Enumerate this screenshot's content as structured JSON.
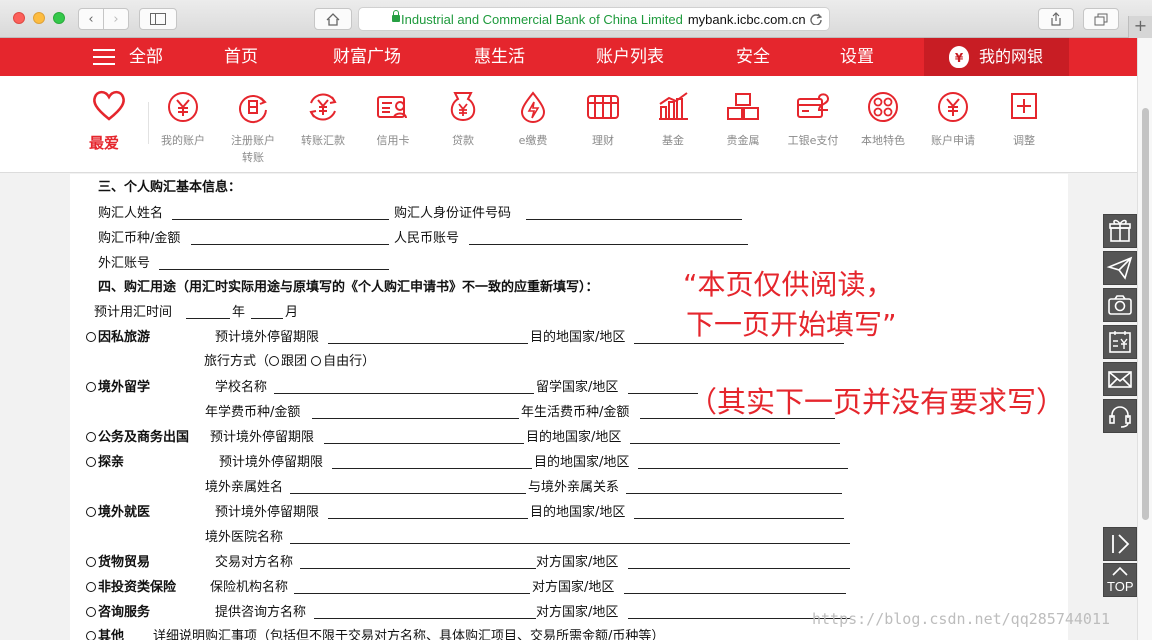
{
  "browser": {
    "url_org": "Industrial and Commercial Bank of China Limited",
    "url_host": "mybank.icbc.com.cn"
  },
  "nav": {
    "all": "全部",
    "items": [
      "首页",
      "财富广场",
      "惠生活",
      "账户列表",
      "安全",
      "设置"
    ],
    "mybank": "我的网银"
  },
  "iconbar": {
    "favorite": "最爱",
    "items": [
      {
        "label": "我的账户",
        "icon": "yuan-coin-icon"
      },
      {
        "label": "注册账户\n转账",
        "icon": "register-transfer-icon"
      },
      {
        "label": "转账汇款",
        "icon": "transfer-icon"
      },
      {
        "label": "信用卡",
        "icon": "credit-card-icon"
      },
      {
        "label": "贷款",
        "icon": "money-bag-icon"
      },
      {
        "label": "e缴费",
        "icon": "flame-drop-icon"
      },
      {
        "label": "理财",
        "icon": "abacus-icon"
      },
      {
        "label": "基金",
        "icon": "bar-chart-icon"
      },
      {
        "label": "贵金属",
        "icon": "gold-bars-icon"
      },
      {
        "label": "工银e支付",
        "icon": "e-pay-card-icon"
      },
      {
        "label": "本地特色",
        "icon": "local-dots-icon"
      },
      {
        "label": "账户申请",
        "icon": "account-apply-icon"
      },
      {
        "label": "调整",
        "icon": "plus-square-icon"
      }
    ],
    "accent": "#e5262d"
  },
  "form": {
    "sec3_title": "三、个人购汇基本信息：",
    "buyer_name": "购汇人姓名",
    "buyer_id": "购汇人身份证件号码",
    "currency_amount": "购汇币种/金额",
    "rmb_account": "人民币账号",
    "fx_account": "外汇账号",
    "sec4_title": "四、购汇用途（用汇时实际用途与原填写的《个人购汇申请书》不一致的应重新填写）：",
    "planned_time": "预计用汇时间",
    "year": "年",
    "month": "月",
    "travel": "因私旅游",
    "stay_period": "预计境外停留期限",
    "dest": "目的地国家/地区",
    "travel_mode": "旅行方式（",
    "group": "跟团",
    "self_guided": "自由行）",
    "study": "境外留学",
    "school": "学校名称",
    "study_country": "留学国家/地区",
    "tuition": "年学费币种/金额",
    "living": "年生活费币种/金额",
    "business": "公务及商务出国",
    "visit": "探亲",
    "relative_name": "境外亲属姓名",
    "relation": "与境外亲属关系",
    "medical": "境外就医",
    "hospital": "境外医院名称",
    "trade": "货物贸易",
    "counterparty": "交易对方名称",
    "counter_country": "对方国家/地区",
    "insurance": "非投资类保险",
    "insurer": "保险机构名称",
    "consulting": "咨询服务",
    "provider": "提供咨询方名称",
    "other": "其他",
    "other_desc": "详细说明购汇事项（包括但不限于交易对方名称、具体购汇项目、交易所需金额/币种等）"
  },
  "annotation": {
    "line1": "“本页仅供阅读，",
    "line2": "下一页开始填写”",
    "line3": "（其实下一页并没有要求写）",
    "color": "#e5262d"
  },
  "side_tools": [
    "gift-icon",
    "paper-plane-icon",
    "camera-icon",
    "calendar-yuan-icon",
    "mail-icon",
    "service-icon"
  ],
  "side_nav": {
    "top": "TOP"
  },
  "watermark": "https://blog.csdn.net/qq285744011"
}
